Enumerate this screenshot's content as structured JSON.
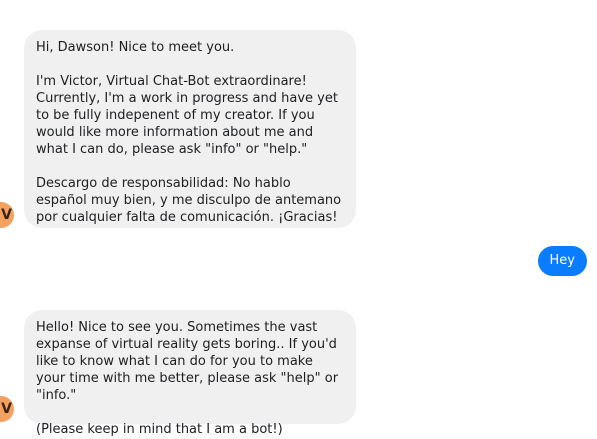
{
  "conversation": {
    "messages": [
      {
        "sender": "bot",
        "text": "Hi, Dawson! Nice to meet you.\n\nI'm Victor, Virtual Chat-Bot extraordinare! Currently, I'm a work in progress and have yet to be fully indepenent of my creator. If you would like more information about me and what I can do, please ask \"info\" or \"help.\"\n\nDescargo de responsabilidad: No hablo español muy bien, y me disculpo de antemano por cualquier falta de comunicación. ¡Gracias!"
      },
      {
        "sender": "user",
        "text": "Hey"
      },
      {
        "sender": "bot",
        "text": "Hello! Nice to see you. Sometimes the vast expanse of virtual reality gets boring.. If you'd like to know what I can do for you to make your time with me better, please ask \"help\" or \"info.\"\n\n(Please keep in mind that I am a bot!)"
      }
    ],
    "bot_avatar_letter": "V"
  },
  "colors": {
    "incoming_bubble": "#f1f0f0",
    "outgoing_bubble": "#0a7cff",
    "avatar": "#f4a05f"
  }
}
